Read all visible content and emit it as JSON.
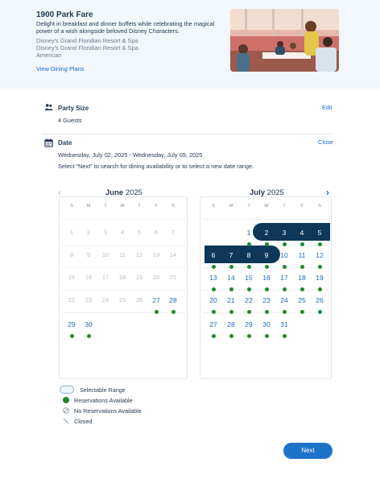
{
  "restaurant": {
    "name": "1900 Park Fare",
    "description": "Delight in breakfast and dinner buffets while celebrating the magical power of a wish alongside beloved Disney Characters.",
    "location_1": "Disney's Grand Floridian Resort & Spa",
    "location_2": "Disney's Grand Floridian Resort & Spa",
    "cuisine": "American",
    "view_plans_link": "View Dining Plans"
  },
  "party": {
    "title": "Party Size",
    "value": "4 Guests",
    "edit_link": "Edit",
    "icon": "people-icon"
  },
  "date": {
    "title": "Date",
    "range_text": "Wednesday, July 02, 2025 - Wednesday, July 09, 2025",
    "instruction": "Select “Next” to search for dining availability or to select a new date range.",
    "close_link": "Close",
    "icon": "calendar-icon"
  },
  "calendar": {
    "weekdays": [
      "S",
      "M",
      "T",
      "W",
      "T",
      "F",
      "S"
    ],
    "months": [
      {
        "name": "June",
        "year": "2025",
        "weeks": [
          [
            "1",
            "2",
            "3",
            "4",
            "5",
            "6",
            "7"
          ],
          [
            "8",
            "9",
            "10",
            "11",
            "12",
            "13",
            "14"
          ],
          [
            "15",
            "16",
            "17",
            "18",
            "19",
            "20",
            "21"
          ],
          [
            "22",
            "23",
            "24",
            "25",
            "26",
            "27",
            "28"
          ],
          [
            "29",
            "30",
            "",
            "",
            "",
            "",
            ""
          ]
        ],
        "past_days": [
          "1",
          "2",
          "3",
          "4",
          "5",
          "6",
          "7",
          "8",
          "9",
          "10",
          "11",
          "12",
          "13",
          "14",
          "15",
          "16",
          "17",
          "18",
          "19",
          "20",
          "21",
          "22",
          "23",
          "24",
          "25",
          "26"
        ],
        "available_days": [
          "27",
          "28",
          "29",
          "30"
        ],
        "selected_days": []
      },
      {
        "name": "July",
        "year": "2025",
        "weeks": [
          [
            "",
            "",
            "1",
            "2",
            "3",
            "4",
            "5"
          ],
          [
            "6",
            "7",
            "8",
            "9",
            "10",
            "11",
            "12"
          ],
          [
            "13",
            "14",
            "15",
            "16",
            "17",
            "18",
            "19"
          ],
          [
            "20",
            "21",
            "22",
            "23",
            "24",
            "25",
            "26"
          ],
          [
            "27",
            "28",
            "29",
            "30",
            "31",
            "",
            ""
          ]
        ],
        "past_days": [],
        "available_days": [
          "1",
          "2",
          "3",
          "4",
          "5",
          "6",
          "7",
          "8",
          "9",
          "10",
          "11",
          "12",
          "13",
          "14",
          "15",
          "16",
          "17",
          "18",
          "19",
          "20",
          "21",
          "22",
          "23",
          "24",
          "25",
          "26",
          "27",
          "28",
          "29",
          "30",
          "31"
        ],
        "selected_days": [
          "2",
          "3",
          "4",
          "5",
          "6",
          "7",
          "8",
          "9"
        ]
      }
    ]
  },
  "legend": {
    "selectable_range": "Selectable Range",
    "reservations_available": "Reservations Available",
    "no_reservations": "No Reservations Available",
    "closed": "Closed"
  },
  "colors": {
    "accent": "#1b6bbd",
    "selected_range": "#0d3857",
    "available_dot": "#1e8a2e",
    "header_bg": "#f1f7fb"
  },
  "next_button": "Next"
}
